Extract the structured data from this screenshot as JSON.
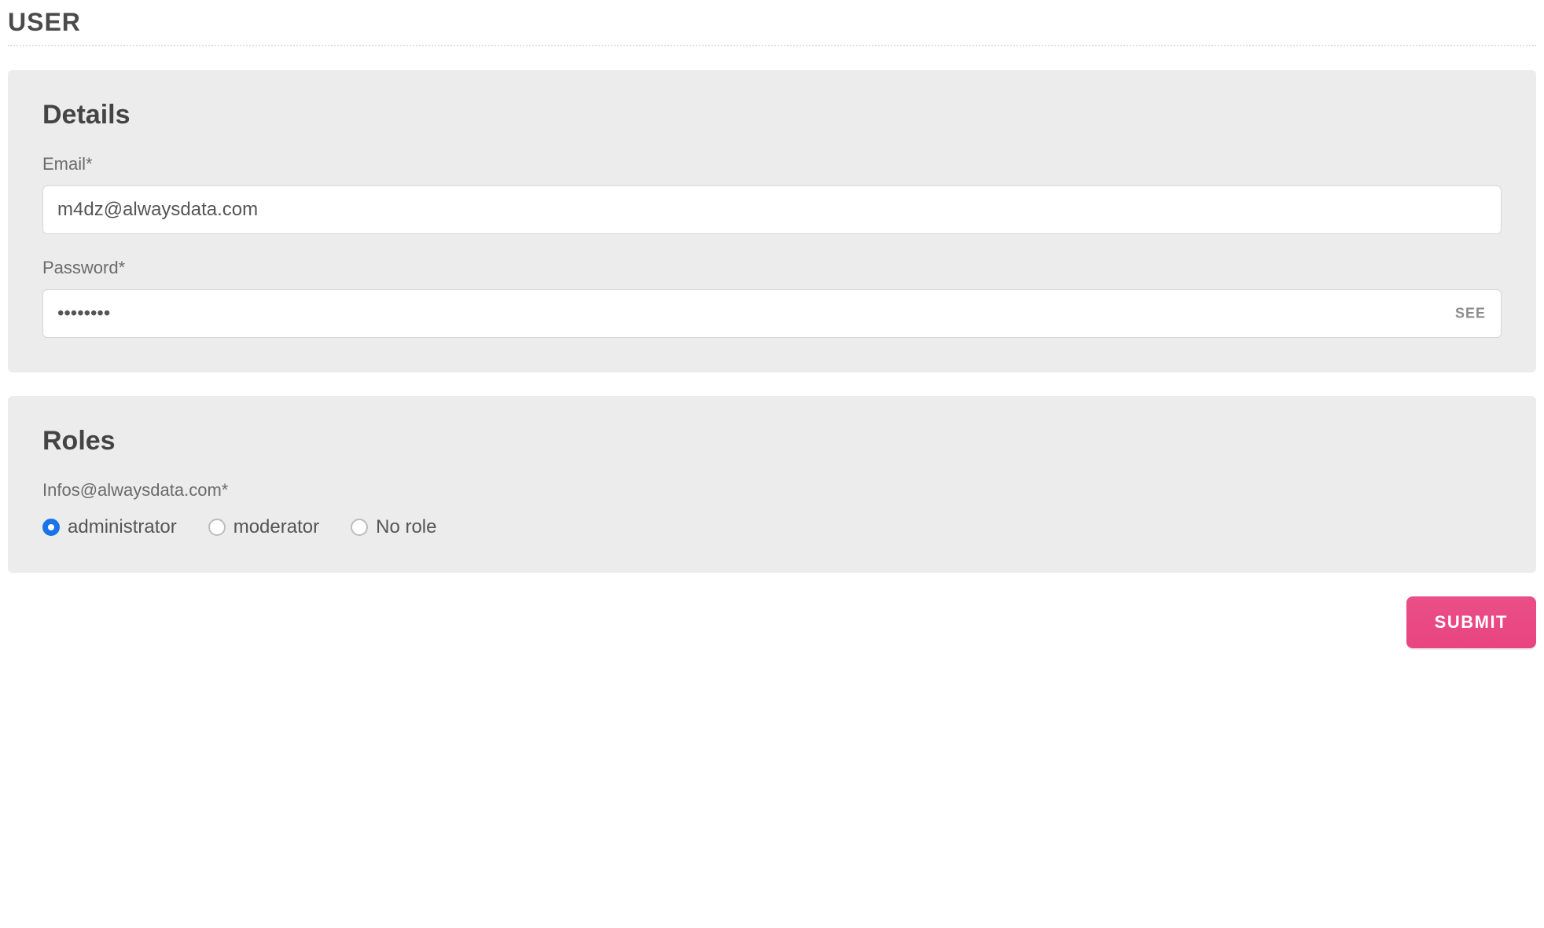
{
  "page": {
    "title": "USER"
  },
  "details": {
    "heading": "Details",
    "email": {
      "label": "Email*",
      "value": "m4dz@alwaysdata.com"
    },
    "password": {
      "label": "Password*",
      "value": "••••••••",
      "see_label": "SEE"
    }
  },
  "roles": {
    "heading": "Roles",
    "subheading": "Infos@alwaysdata.com*",
    "options": [
      {
        "label": "administrator",
        "selected": true
      },
      {
        "label": "moderator",
        "selected": false
      },
      {
        "label": "No role",
        "selected": false
      }
    ]
  },
  "actions": {
    "submit_label": "SUBMIT"
  }
}
